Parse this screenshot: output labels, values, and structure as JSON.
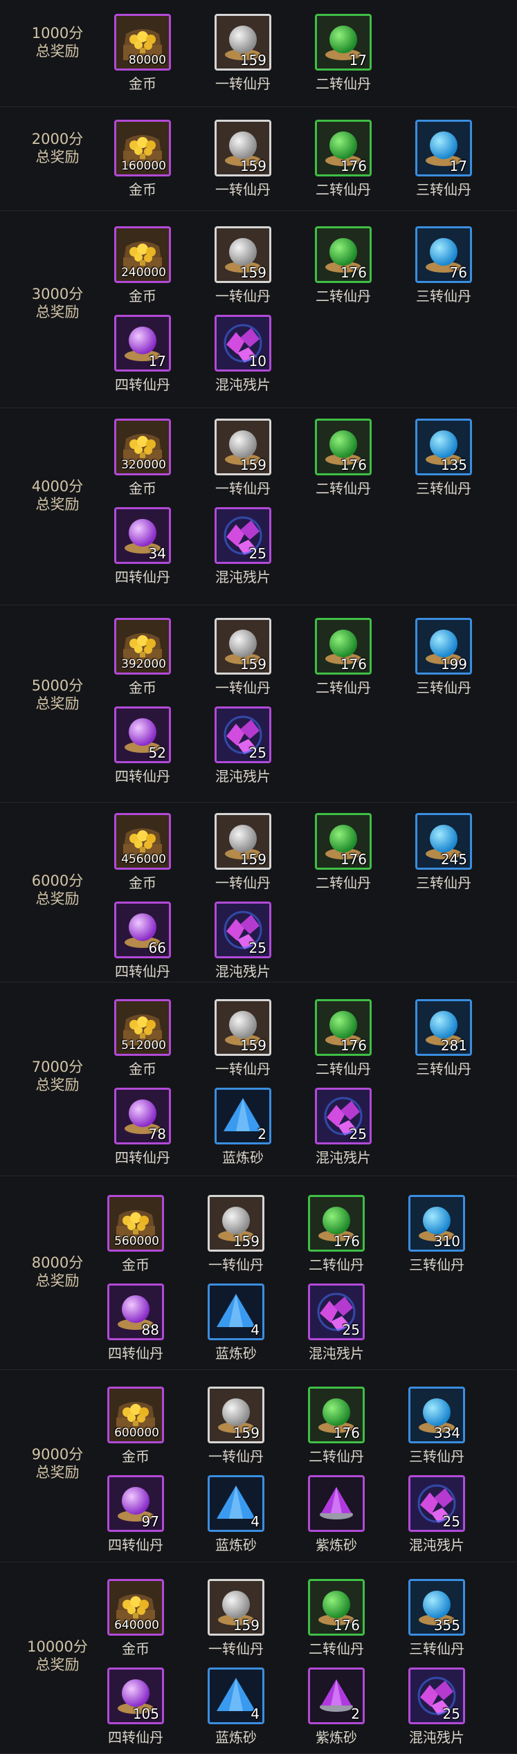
{
  "tiers": [
    {
      "label_top": "1000分",
      "label_bottom": "总奖励",
      "items": [
        {
          "name": "金币",
          "qty": "80000",
          "icon": "gold-chest-icon"
        },
        {
          "name": "一转仙丹",
          "qty": "159",
          "icon": "white-pill-icon"
        },
        {
          "name": "二转仙丹",
          "qty": "17",
          "icon": "green-pill-icon"
        }
      ]
    },
    {
      "label_top": "2000分",
      "label_bottom": "总奖励",
      "items": [
        {
          "name": "金币",
          "qty": "160000",
          "icon": "gold-chest-icon"
        },
        {
          "name": "一转仙丹",
          "qty": "159",
          "icon": "white-pill-icon"
        },
        {
          "name": "二转仙丹",
          "qty": "176",
          "icon": "green-pill-icon"
        },
        {
          "name": "三转仙丹",
          "qty": "17",
          "icon": "blue-pill-icon"
        }
      ]
    },
    {
      "label_top": "3000分",
      "label_bottom": "总奖励",
      "items": [
        {
          "name": "金币",
          "qty": "240000",
          "icon": "gold-chest-icon"
        },
        {
          "name": "一转仙丹",
          "qty": "159",
          "icon": "white-pill-icon"
        },
        {
          "name": "二转仙丹",
          "qty": "176",
          "icon": "green-pill-icon"
        },
        {
          "name": "三转仙丹",
          "qty": "76",
          "icon": "blue-pill-icon"
        },
        {
          "name": "四转仙丹",
          "qty": "17",
          "icon": "purple-pill-icon"
        },
        {
          "name": "混沌残片",
          "qty": "10",
          "icon": "chaos-shard-icon"
        }
      ]
    },
    {
      "label_top": "4000分",
      "label_bottom": "总奖励",
      "items": [
        {
          "name": "金币",
          "qty": "320000",
          "icon": "gold-chest-icon"
        },
        {
          "name": "一转仙丹",
          "qty": "159",
          "icon": "white-pill-icon"
        },
        {
          "name": "二转仙丹",
          "qty": "176",
          "icon": "green-pill-icon"
        },
        {
          "name": "三转仙丹",
          "qty": "135",
          "icon": "blue-pill-icon"
        },
        {
          "name": "四转仙丹",
          "qty": "34",
          "icon": "purple-pill-icon"
        },
        {
          "name": "混沌残片",
          "qty": "25",
          "icon": "chaos-shard-icon"
        }
      ]
    },
    {
      "label_top": "5000分",
      "label_bottom": "总奖励",
      "items": [
        {
          "name": "金币",
          "qty": "392000",
          "icon": "gold-chest-icon"
        },
        {
          "name": "一转仙丹",
          "qty": "159",
          "icon": "white-pill-icon"
        },
        {
          "name": "二转仙丹",
          "qty": "176",
          "icon": "green-pill-icon"
        },
        {
          "name": "三转仙丹",
          "qty": "199",
          "icon": "blue-pill-icon"
        },
        {
          "name": "四转仙丹",
          "qty": "52",
          "icon": "purple-pill-icon"
        },
        {
          "name": "混沌残片",
          "qty": "25",
          "icon": "chaos-shard-icon"
        }
      ]
    },
    {
      "label_top": "6000分",
      "label_bottom": "总奖励",
      "items": [
        {
          "name": "金币",
          "qty": "456000",
          "icon": "gold-chest-icon"
        },
        {
          "name": "一转仙丹",
          "qty": "159",
          "icon": "white-pill-icon"
        },
        {
          "name": "二转仙丹",
          "qty": "176",
          "icon": "green-pill-icon"
        },
        {
          "name": "三转仙丹",
          "qty": "245",
          "icon": "blue-pill-icon"
        },
        {
          "name": "四转仙丹",
          "qty": "66",
          "icon": "purple-pill-icon"
        },
        {
          "name": "混沌残片",
          "qty": "25",
          "icon": "chaos-shard-icon"
        }
      ]
    },
    {
      "label_top": "7000分",
      "label_bottom": "总奖励",
      "items": [
        {
          "name": "金币",
          "qty": "512000",
          "icon": "gold-chest-icon"
        },
        {
          "name": "一转仙丹",
          "qty": "159",
          "icon": "white-pill-icon"
        },
        {
          "name": "二转仙丹",
          "qty": "176",
          "icon": "green-pill-icon"
        },
        {
          "name": "三转仙丹",
          "qty": "281",
          "icon": "blue-pill-icon"
        },
        {
          "name": "四转仙丹",
          "qty": "78",
          "icon": "purple-pill-icon"
        },
        {
          "name": "蓝炼砂",
          "qty": "2",
          "icon": "blue-sand-icon"
        },
        {
          "name": "混沌残片",
          "qty": "25",
          "icon": "chaos-shard-icon"
        }
      ]
    },
    {
      "label_top": "8000分",
      "label_bottom": "总奖励",
      "items": [
        {
          "name": "金币",
          "qty": "560000",
          "icon": "gold-chest-icon"
        },
        {
          "name": "一转仙丹",
          "qty": "159",
          "icon": "white-pill-icon"
        },
        {
          "name": "二转仙丹",
          "qty": "176",
          "icon": "green-pill-icon"
        },
        {
          "name": "三转仙丹",
          "qty": "310",
          "icon": "blue-pill-icon"
        },
        {
          "name": "四转仙丹",
          "qty": "88",
          "icon": "purple-pill-icon"
        },
        {
          "name": "蓝炼砂",
          "qty": "4",
          "icon": "blue-sand-icon"
        },
        {
          "name": "混沌残片",
          "qty": "25",
          "icon": "chaos-shard-icon"
        }
      ]
    },
    {
      "label_top": "9000分",
      "label_bottom": "总奖励",
      "items": [
        {
          "name": "金币",
          "qty": "600000",
          "icon": "gold-chest-icon"
        },
        {
          "name": "一转仙丹",
          "qty": "159",
          "icon": "white-pill-icon"
        },
        {
          "name": "二转仙丹",
          "qty": "176",
          "icon": "green-pill-icon"
        },
        {
          "name": "三转仙丹",
          "qty": "334",
          "icon": "blue-pill-icon"
        },
        {
          "name": "四转仙丹",
          "qty": "97",
          "icon": "purple-pill-icon"
        },
        {
          "name": "蓝炼砂",
          "qty": "4",
          "icon": "blue-sand-icon"
        },
        {
          "name": "紫炼砂",
          "qty": "",
          "icon": "purple-sand-icon"
        },
        {
          "name": "混沌残片",
          "qty": "25",
          "icon": "chaos-shard-icon"
        }
      ]
    },
    {
      "label_top": "10000分",
      "label_bottom": "总奖励",
      "items": [
        {
          "name": "金币",
          "qty": "640000",
          "icon": "gold-chest-icon"
        },
        {
          "name": "一转仙丹",
          "qty": "159",
          "icon": "white-pill-icon"
        },
        {
          "name": "二转仙丹",
          "qty": "176",
          "icon": "green-pill-icon"
        },
        {
          "name": "三转仙丹",
          "qty": "355",
          "icon": "blue-pill-icon"
        },
        {
          "name": "四转仙丹",
          "qty": "105",
          "icon": "purple-pill-icon"
        },
        {
          "name": "蓝炼砂",
          "qty": "4",
          "icon": "blue-sand-icon"
        },
        {
          "name": "紫炼砂",
          "qty": "2",
          "icon": "purple-sand-icon"
        },
        {
          "name": "混沌残片",
          "qty": "25",
          "icon": "chaos-shard-icon"
        }
      ]
    }
  ],
  "colors": {
    "background": "#141518",
    "rarity_purple": "#b24ad8",
    "rarity_white": "#d6d6d6",
    "rarity_green": "#3fbf46",
    "rarity_blue": "#3a8ee0",
    "label_text": "#d2c5a8"
  }
}
